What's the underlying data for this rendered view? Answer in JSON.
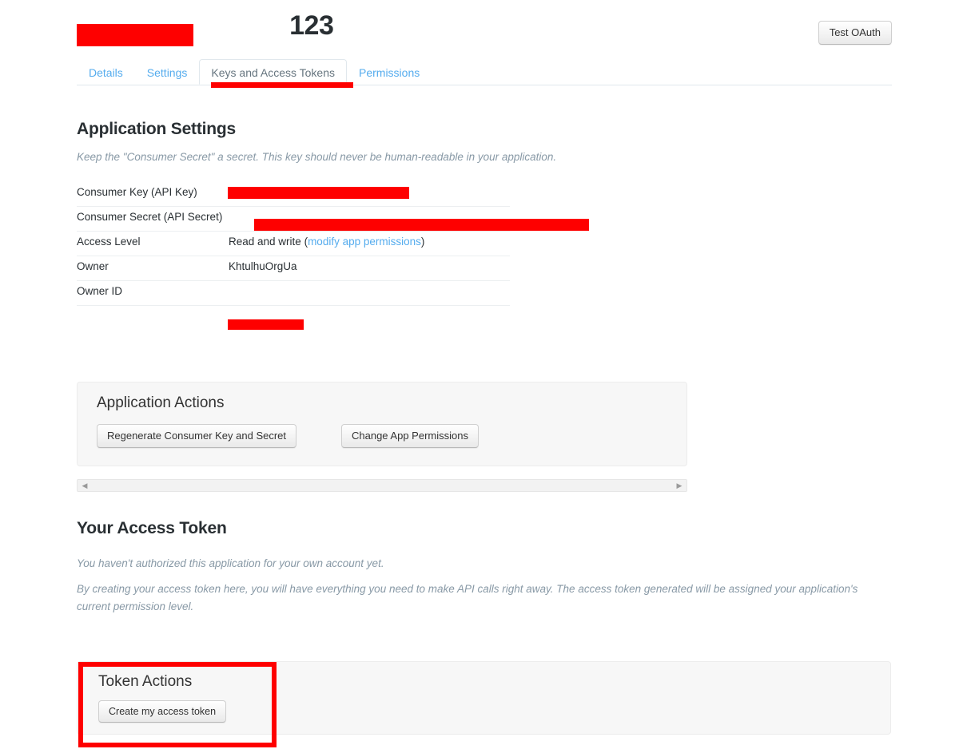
{
  "header": {
    "app_title_visible_suffix": "123",
    "app_title_redacted": true,
    "test_oauth_label": "Test OAuth"
  },
  "tabs": [
    {
      "label": "Details",
      "active": false
    },
    {
      "label": "Settings",
      "active": false
    },
    {
      "label": "Keys and Access Tokens",
      "active": true
    },
    {
      "label": "Permissions",
      "active": false
    }
  ],
  "application_settings": {
    "title": "Application Settings",
    "note": "Keep the \"Consumer Secret\" a secret. This key should never be human-readable in your application.",
    "rows": [
      {
        "label": "Consumer Key (API Key)",
        "value": "",
        "redacted": true
      },
      {
        "label": "Consumer Secret (API Secret)",
        "value": "",
        "redacted": true
      },
      {
        "label": "Access Level",
        "value": "Read and write",
        "link": "modify app permissions",
        "redacted": false
      },
      {
        "label": "Owner",
        "value": "KhtulhuOrgUa",
        "redacted": false
      },
      {
        "label": "Owner ID",
        "value": "",
        "redacted": true
      }
    ]
  },
  "application_actions": {
    "title": "Application Actions",
    "regenerate_label": "Regenerate Consumer Key and Secret",
    "change_permissions_label": "Change App Permissions"
  },
  "scrollbar": {
    "left_arrow": "◀",
    "right_arrow": "▶"
  },
  "access_token": {
    "title": "Your Access Token",
    "note1": "You haven't authorized this application for your own account yet.",
    "note2": "By creating your access token here, you will have everything you need to make API calls right away. The access token generated will be assigned your application's current permission level."
  },
  "token_actions": {
    "title": "Token Actions",
    "create_label": "Create my access token"
  },
  "colors": {
    "link_blue": "#55acee",
    "tab_active_text": "#66757f",
    "annotation_red": "#fe0000",
    "text": "#292f33",
    "muted_italic": "#8899a6",
    "well_bg": "#f7f7f7",
    "border": "#e1e8ed"
  }
}
